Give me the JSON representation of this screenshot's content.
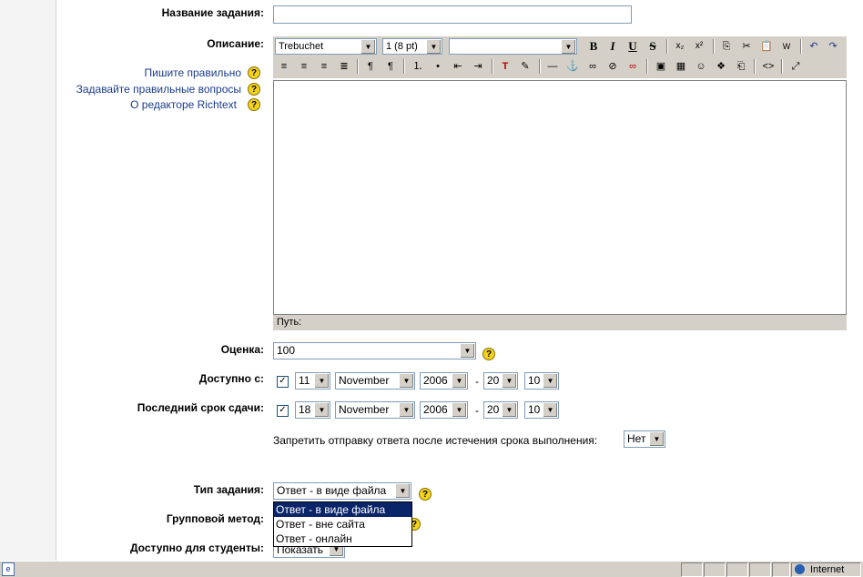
{
  "form": {
    "task_name": {
      "label": "Название задания:",
      "value": ""
    },
    "description": {
      "label": "Описание:"
    },
    "help_links": [
      {
        "label": "Пишите правильно"
      },
      {
        "label": "Задавайте правильные вопросы"
      },
      {
        "label": "О редакторе Richtext"
      }
    ],
    "editor": {
      "font_value": "Trebuchet",
      "size_value": "1 (8 pt)",
      "style_value": "",
      "path_label": "Путь:"
    },
    "grade": {
      "label": "Оценка:",
      "value": "100"
    },
    "available_from": {
      "label": "Доступно с:",
      "checked": true,
      "day": "11",
      "month": "November",
      "year": "2006",
      "hour": "20",
      "minute": "10"
    },
    "due_date": {
      "label": "Последний срок сдачи:",
      "checked": true,
      "day": "18",
      "month": "November",
      "year": "2006",
      "hour": "20",
      "minute": "10"
    },
    "prevent_late": {
      "label": "Запретить отправку ответа после истечения срока выполнения:",
      "value": "Нет"
    },
    "assignment_type": {
      "label": "Тип задания:",
      "value": "Ответ - в виде файла",
      "options": [
        "Ответ - в виде файла",
        "Ответ - вне сайта",
        "Ответ - онлайн"
      ]
    },
    "group_mode": {
      "label": "Групповой метод:"
    },
    "visible": {
      "label": "Доступно для студенты:",
      "value": "Показать"
    }
  },
  "toolbar": {
    "bold": "B",
    "italic": "I",
    "underline": "U",
    "strike": "S",
    "subscript": "x₂",
    "superscript": "x²",
    "undo": "↶",
    "redo": "↷"
  },
  "status_bar": {
    "zone": "Internet"
  },
  "help_symbol": "?",
  "colors": {
    "link": "#1a3b8c",
    "toolbar": "#d4d0c8",
    "selection": "#0a246a"
  }
}
